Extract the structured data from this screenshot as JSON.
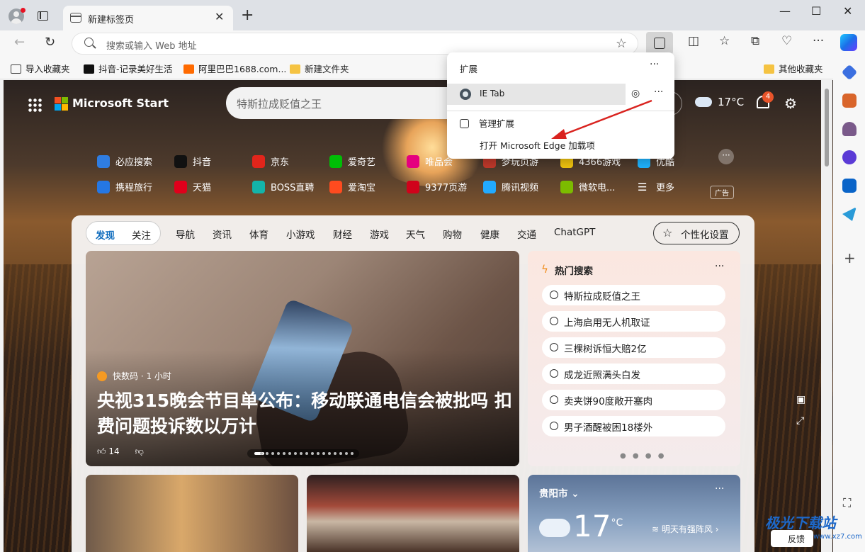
{
  "tab": {
    "title": "新建标签页"
  },
  "address": {
    "placeholder": "搜索或输入 Web 地址"
  },
  "favorites": [
    {
      "label": "导入收藏夹"
    },
    {
      "label": "抖音-记录美好生活"
    },
    {
      "label": "阿里巴巴1688.com..."
    },
    {
      "label": "新建文件夹"
    },
    {
      "label": "其他收藏夹"
    }
  ],
  "start": {
    "brand": "Microsoft Start",
    "search_placeholder": "特斯拉成贬值之王",
    "weather_temp": "17°C",
    "notif_count": "4"
  },
  "quick_links": [
    {
      "label": "必应搜索"
    },
    {
      "label": "抖音"
    },
    {
      "label": "京东"
    },
    {
      "label": "爱奇艺"
    },
    {
      "label": "唯品会"
    },
    {
      "label": "梦玩页游"
    },
    {
      "label": "4366游戏"
    },
    {
      "label": "优酷"
    },
    {
      "label": "携程旅行"
    },
    {
      "label": "天猫"
    },
    {
      "label": "BOSS直聘"
    },
    {
      "label": "爱淘宝"
    },
    {
      "label": "9377页游"
    },
    {
      "label": "腾讯视频"
    },
    {
      "label": "微软电..."
    },
    {
      "label": "更多"
    }
  ],
  "ad_label": "广告",
  "feed": {
    "pills": [
      "发现",
      "关注"
    ],
    "nav": [
      "导航",
      "资讯",
      "体育",
      "小游戏",
      "财经",
      "游戏",
      "天气",
      "购物",
      "健康",
      "交通",
      "ChatGPT"
    ],
    "personalize": "个性化设置"
  },
  "hero": {
    "source": "快数码 · 1 小时",
    "title": "央视315晚会节目单公布：移动联通电信会被批吗 扣费问题投诉数以万计",
    "likes": "14"
  },
  "trending": {
    "title": "热门搜索",
    "items": [
      "特斯拉成贬值之王",
      "上海启用无人机取证",
      "三棵树诉恒大赔2亿",
      "成龙近照满头白发",
      "卖夹饼90度敞开塞肉",
      "男子酒醒被困18楼外"
    ]
  },
  "weather": {
    "city": "贵阳市",
    "temp": "17",
    "unit": "°C",
    "tomorrow": "明天有强阵风"
  },
  "menu": {
    "title": "扩展",
    "ext_name": "IE Tab",
    "manage": "管理扩展",
    "open_addons": "打开 Microsoft Edge 加载项"
  },
  "feedback": "反馈",
  "watermark": {
    "main": "极光下载站",
    "sub": "www.xz7.com"
  },
  "colors": {
    "accent": "#0f6cbd",
    "arrow": "#d9231f",
    "notif": "#e8542a"
  }
}
